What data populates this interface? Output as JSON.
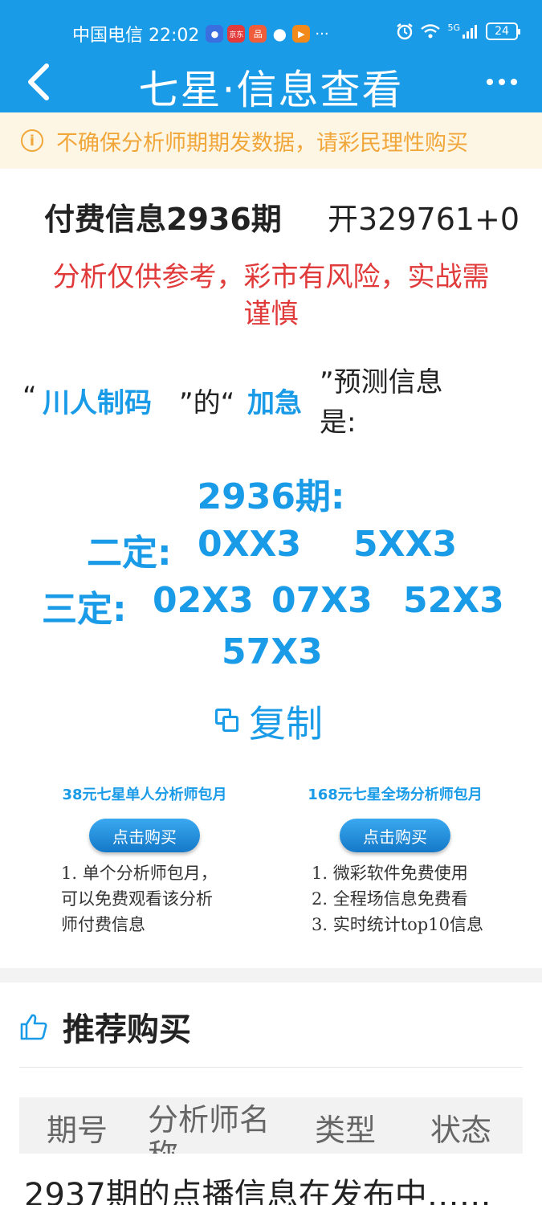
{
  "status_bar": {
    "carrier_time": "中国电信 22:02",
    "apps": [
      "●",
      "京东",
      "品",
      "●",
      "▶"
    ],
    "more": "···",
    "network": "5G",
    "battery": "24"
  },
  "header": {
    "title": "七星·信息查看"
  },
  "notice": {
    "icon": "info-icon",
    "text": "不确保分析师期期发数据，请彩民理性购买"
  },
  "issue": {
    "title": "付费信息2936期",
    "result": "开329761+0"
  },
  "warning": "分析仅供参考，彩市有风险，实战需谨慎",
  "prediction": {
    "quote1": "“",
    "analyst": "川人制码",
    "quote2": "”的“",
    "type": "加急",
    "quote3": "”预测信息",
    "is": "是:",
    "period": "2936期:",
    "two_label": "二定:",
    "two_values": [
      "0XX3",
      "5XX3"
    ],
    "three_label": "三定:",
    "three_values": [
      "02X3",
      "07X3",
      "52X3",
      "57X3"
    ]
  },
  "copy": {
    "label": "复制",
    "icon": "copy-icon"
  },
  "packages": [
    {
      "title": "38元七星单人分析师包月",
      "button": "点击购买",
      "lines": [
        "1. 单个分析师包月，",
        "可以免费观看该分析",
        "师付费信息"
      ]
    },
    {
      "title": "168元七星全场分析师包月",
      "button": "点击购买",
      "lines": [
        "1. 微彩软件免费使用",
        "2. 全程场信息免费看",
        "3. 实时统计top10信息"
      ]
    }
  ],
  "recommend": {
    "icon": "thumbs-up-icon",
    "title": "推荐购买",
    "columns": [
      "期号",
      "分析师名称",
      "类型",
      "状态"
    ]
  },
  "status_line": "2937期的点播信息在发布中……",
  "colors": {
    "primary": "#1a9be8",
    "warning": "#e03a3a",
    "notice": "#f1a63a"
  }
}
